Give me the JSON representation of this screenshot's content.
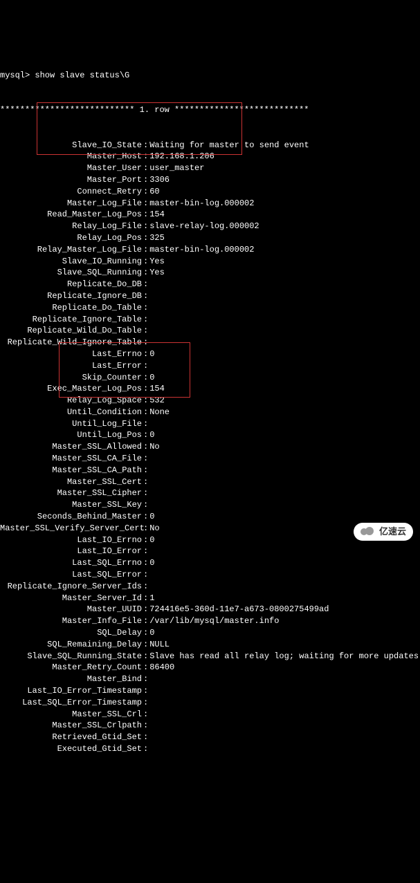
{
  "prompt": "mysql> show slave status\\G",
  "row_header": "*************************** 1. row ***************************",
  "fields": [
    {
      "label": "Slave_IO_State",
      "value": "Waiting for master to send event"
    },
    {
      "label": "Master_Host",
      "value": "192.168.1.206"
    },
    {
      "label": "Master_User",
      "value": "user_master"
    },
    {
      "label": "Master_Port",
      "value": "3306"
    },
    {
      "label": "Connect_Retry",
      "value": "60"
    },
    {
      "label": "Master_Log_File",
      "value": "master-bin-log.000002"
    },
    {
      "label": "Read_Master_Log_Pos",
      "value": "154"
    },
    {
      "label": "Relay_Log_File",
      "value": "slave-relay-log.000002"
    },
    {
      "label": "Relay_Log_Pos",
      "value": "325"
    },
    {
      "label": "Relay_Master_Log_File",
      "value": "master-bin-log.000002"
    },
    {
      "label": "Slave_IO_Running",
      "value": "Yes"
    },
    {
      "label": "Slave_SQL_Running",
      "value": "Yes"
    },
    {
      "label": "Replicate_Do_DB",
      "value": ""
    },
    {
      "label": "Replicate_Ignore_DB",
      "value": ""
    },
    {
      "label": "Replicate_Do_Table",
      "value": ""
    },
    {
      "label": "Replicate_Ignore_Table",
      "value": ""
    },
    {
      "label": "Replicate_Wild_Do_Table",
      "value": ""
    },
    {
      "label": "Replicate_Wild_Ignore_Table",
      "value": ""
    },
    {
      "label": "Last_Errno",
      "value": "0"
    },
    {
      "label": "Last_Error",
      "value": ""
    },
    {
      "label": "Skip_Counter",
      "value": "0"
    },
    {
      "label": "Exec_Master_Log_Pos",
      "value": "154"
    },
    {
      "label": "Relay_Log_Space",
      "value": "532"
    },
    {
      "label": "Until_Condition",
      "value": "None"
    },
    {
      "label": "Until_Log_File",
      "value": ""
    },
    {
      "label": "Until_Log_Pos",
      "value": "0"
    },
    {
      "label": "Master_SSL_Allowed",
      "value": "No"
    },
    {
      "label": "Master_SSL_CA_File",
      "value": ""
    },
    {
      "label": "Master_SSL_CA_Path",
      "value": ""
    },
    {
      "label": "Master_SSL_Cert",
      "value": ""
    },
    {
      "label": "Master_SSL_Cipher",
      "value": ""
    },
    {
      "label": "Master_SSL_Key",
      "value": ""
    },
    {
      "label": "Seconds_Behind_Master",
      "value": "0"
    },
    {
      "label": "Master_SSL_Verify_Server_Cert",
      "value": "No"
    },
    {
      "label": "Last_IO_Errno",
      "value": "0"
    },
    {
      "label": "Last_IO_Error",
      "value": ""
    },
    {
      "label": "Last_SQL_Errno",
      "value": "0"
    },
    {
      "label": "Last_SQL_Error",
      "value": ""
    },
    {
      "label": "Replicate_Ignore_Server_Ids",
      "value": ""
    },
    {
      "label": "Master_Server_Id",
      "value": "1"
    },
    {
      "label": "Master_UUID",
      "value": "724416e5-360d-11e7-a673-0800275499ad"
    },
    {
      "label": "Master_Info_File",
      "value": "/var/lib/mysql/master.info"
    },
    {
      "label": "SQL_Delay",
      "value": "0"
    },
    {
      "label": "SQL_Remaining_Delay",
      "value": "NULL"
    },
    {
      "label": "Slave_SQL_Running_State",
      "value": "Slave has read all relay log; waiting for more updates"
    },
    {
      "label": "Master_Retry_Count",
      "value": "86400"
    },
    {
      "label": "Master_Bind",
      "value": ""
    },
    {
      "label": "Last_IO_Error_Timestamp",
      "value": ""
    },
    {
      "label": "Last_SQL_Error_Timestamp",
      "value": ""
    },
    {
      "label": "Master_SSL_Crl",
      "value": ""
    },
    {
      "label": "Master_SSL_Crlpath",
      "value": ""
    },
    {
      "label": "Retrieved_Gtid_Set",
      "value": ""
    },
    {
      "label": "Executed_Gtid_Set",
      "value": ""
    }
  ],
  "logo_text": "亿速云"
}
